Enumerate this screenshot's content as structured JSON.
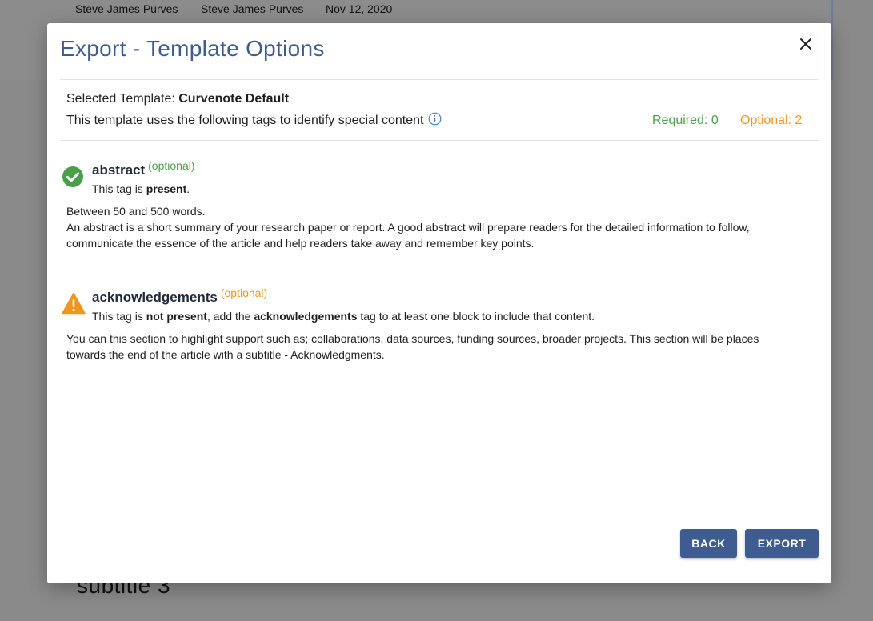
{
  "background": {
    "row": [
      "Steve James Purves",
      "Steve James Purves",
      "Nov 12, 2020"
    ],
    "subtitle": "subtitle 3"
  },
  "dialog": {
    "title": "Export - Template Options",
    "selected_template_label": "Selected Template: ",
    "selected_template_name": "Curvenote Default",
    "tags_description": "This template uses the following tags to identify special content",
    "required_label": "Required: 0",
    "optional_label": "Optional: 2",
    "tags": [
      {
        "name": "abstract",
        "optional_label": "(optional)",
        "status_prefix": "This tag is ",
        "status_value": "present",
        "status_suffix": ".",
        "description_line1": "Between 50 and 500 words.",
        "description_line2": "An abstract is a short summary of your research paper or report. A good abstract will prepare readers for the detailed information to follow, communicate the essence of the article and help readers take away and remember key points."
      },
      {
        "name": "acknowledgements",
        "optional_label": "(optional)",
        "status_prefix": "This tag is ",
        "status_value": "not present",
        "status_middle": ", add the ",
        "status_tag": "acknowledgements",
        "status_suffix": " tag to at least one block to include that content.",
        "description": "You can this section to highlight support such as; collaborations, data sources, funding sources, broader projects. This section will be places towards the end of the article with a subtitle - Acknowledgments."
      }
    ],
    "buttons": {
      "back": "BACK",
      "export": "EXPORT"
    }
  },
  "colors": {
    "accent": "#3e5c8f",
    "success": "#4aa04a",
    "warning": "#f0961c"
  },
  "icons": [
    "close-icon",
    "info-icon",
    "check-circle-icon",
    "warning-icon"
  ]
}
